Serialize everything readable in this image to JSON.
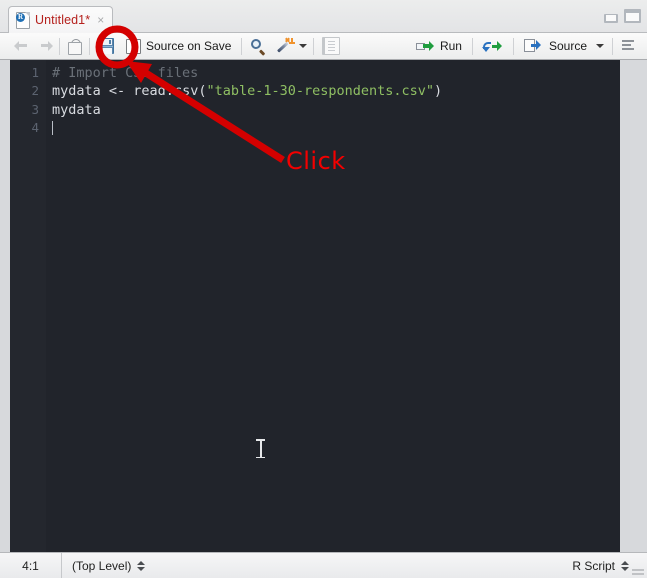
{
  "window": {
    "minimize_icon": "minimize-panel-icon",
    "maximize_icon": "maximize-panel-icon"
  },
  "tab": {
    "doc_icon": "r-script-file-icon",
    "title": "Untitled1*",
    "close_glyph": "×",
    "title_color": "#b5211d"
  },
  "toolbar": {
    "back_icon": "back-arrow-icon",
    "forward_icon": "forward-arrow-icon",
    "popout_icon": "show-in-new-window-icon",
    "save_icon": "save-icon",
    "source_on_save_label": "Source on Save",
    "find_icon": "find-replace-icon",
    "code_tools_icon": "code-tools-magic-wand-icon",
    "code_tools_caret": "chevron-down-icon",
    "compile_report_icon": "compile-report-icon",
    "run_icon": "run-icon",
    "run_label": "Run",
    "rerun_icon": "rerun-previous-icon",
    "source_icon": "source-icon",
    "source_label": "Source",
    "source_caret": "chevron-down-icon",
    "outline_icon": "document-outline-icon"
  },
  "editor": {
    "lines": [
      {
        "number": "1",
        "tokens": [
          {
            "text": "# Import CSV files",
            "type": "comment"
          }
        ]
      },
      {
        "number": "2",
        "tokens": [
          {
            "text": "mydata ",
            "type": "plain"
          },
          {
            "text": "<-",
            "type": "op"
          },
          {
            "text": " read.csv(",
            "type": "plain"
          },
          {
            "text": "\"table-1-30-respondents.csv\"",
            "type": "str"
          },
          {
            "text": ")",
            "type": "paren"
          }
        ]
      },
      {
        "number": "3",
        "tokens": [
          {
            "text": "mydata",
            "type": "plain"
          }
        ]
      },
      {
        "number": "4",
        "tokens": []
      }
    ],
    "background_color": "#21242b",
    "gutter_color": "#24272e",
    "comment_color": "#6a7078",
    "string_color": "#8fbf63",
    "text_color": "#d8dbe0",
    "linenumber_color": "#5c6370",
    "mouse_cursor": "text-ibeam-cursor"
  },
  "annotations": {
    "click_label": "Click",
    "click_color": "#f40000",
    "highlight_circle": "red-highlight-circle",
    "pointer_arrow": "red-pointer-arrow"
  },
  "statusbar": {
    "cursor_position": "4:1",
    "scope": "(Top Level)",
    "scope_stepper": "up-down-stepper-icon",
    "file_type": "R Script",
    "file_type_stepper": "up-down-stepper-icon",
    "resize_grip": "resize-grip-icon"
  }
}
